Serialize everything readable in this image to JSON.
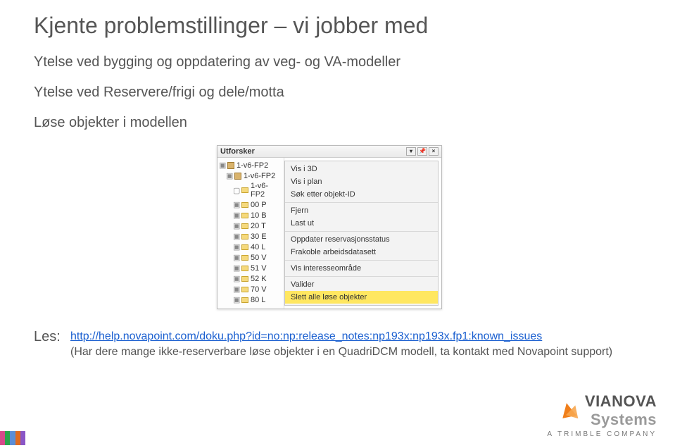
{
  "title": "Kjente problemstillinger – vi jobber med",
  "paragraphs": {
    "p1": "Ytelse ved bygging og oppdatering av veg- og VA-modeller",
    "p2": "Ytelse ved Reservere/frigi og dele/motta",
    "p3": "Løse objekter i modellen"
  },
  "mini_ui": {
    "pane_title": "Utforsker",
    "tree": {
      "root": "1-v6-FP2",
      "child1": "1-v6-FP2",
      "leaves": [
        "1-v6-FP2",
        "00 P",
        "10 B",
        "20 T",
        "30 E",
        "40 L",
        "50 V",
        "51 V",
        "52 K",
        "70 V",
        "80 L"
      ]
    },
    "context_menu": [
      "Vis i 3D",
      "Vis i plan",
      "Søk etter objekt-ID",
      "Fjern",
      "Last ut",
      "Oppdater reservasjonsstatus",
      "Frakoble arbeidsdatasett",
      "Vis interesseområde",
      "Valider",
      "Slett alle løse objekter"
    ]
  },
  "les": {
    "label": "Les:",
    "link_text": "http://help.novapoint.com/doku.php?id=no:np:release_notes:np193x:np193x.fp1:known_issues",
    "link_href": "http://help.novapoint.com/doku.php?id=no:np:release_notes:np193x:np193x.fp1:known_issues",
    "note": "(Har dere mange ikke-reserverbare løse objekter i en QuadriDCM modell, ta kontakt med Novapoint support)"
  },
  "brand": {
    "name_strong": "VIANOVA",
    "name_light": "Systems",
    "subtitle": "A  TRIMBLE  COMPANY"
  }
}
